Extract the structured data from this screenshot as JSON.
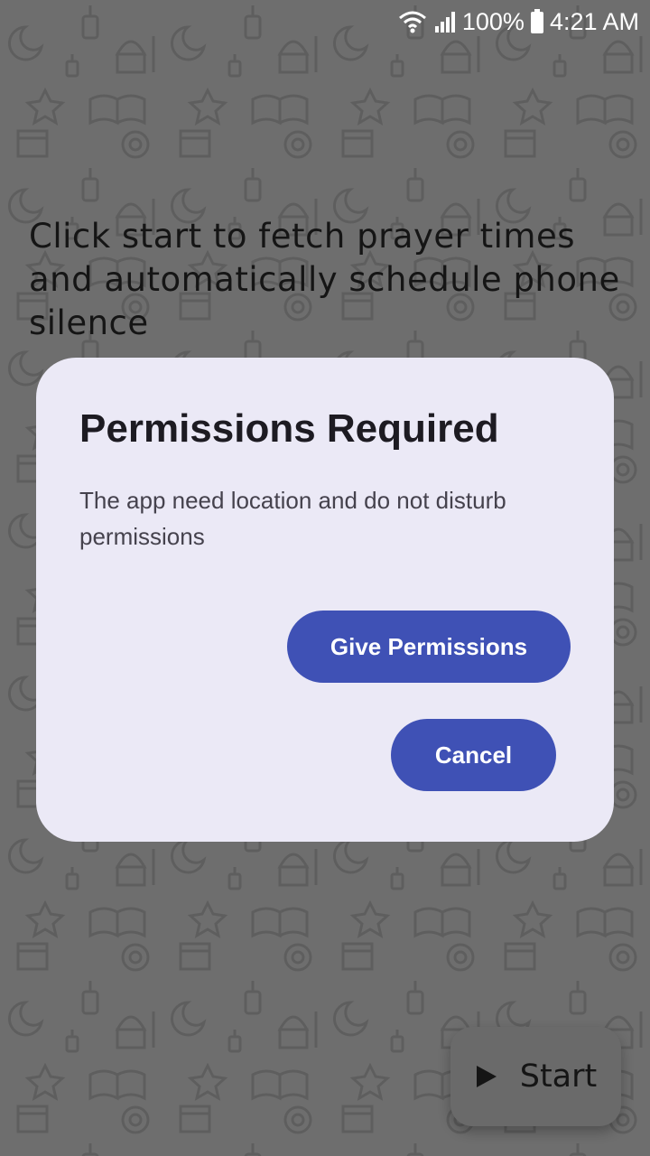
{
  "status_bar": {
    "battery_percent": "100%",
    "time": "4:21 AM",
    "icons": [
      "wifi-icon",
      "signal-icon",
      "battery-icon"
    ]
  },
  "main": {
    "headline": "Click start to fetch prayer times and automatically schedule phone silence",
    "fab": {
      "label": "Start",
      "icon": "play-icon"
    }
  },
  "dialog": {
    "title": "Permissions Required",
    "message": "The app need location and do not disturb permissions",
    "give_label": "Give Permissions",
    "cancel_label": "Cancel"
  },
  "colors": {
    "scrim": "#6e6e6e",
    "dialog_bg": "#ebe9f6",
    "accent": "#3f51b5"
  }
}
